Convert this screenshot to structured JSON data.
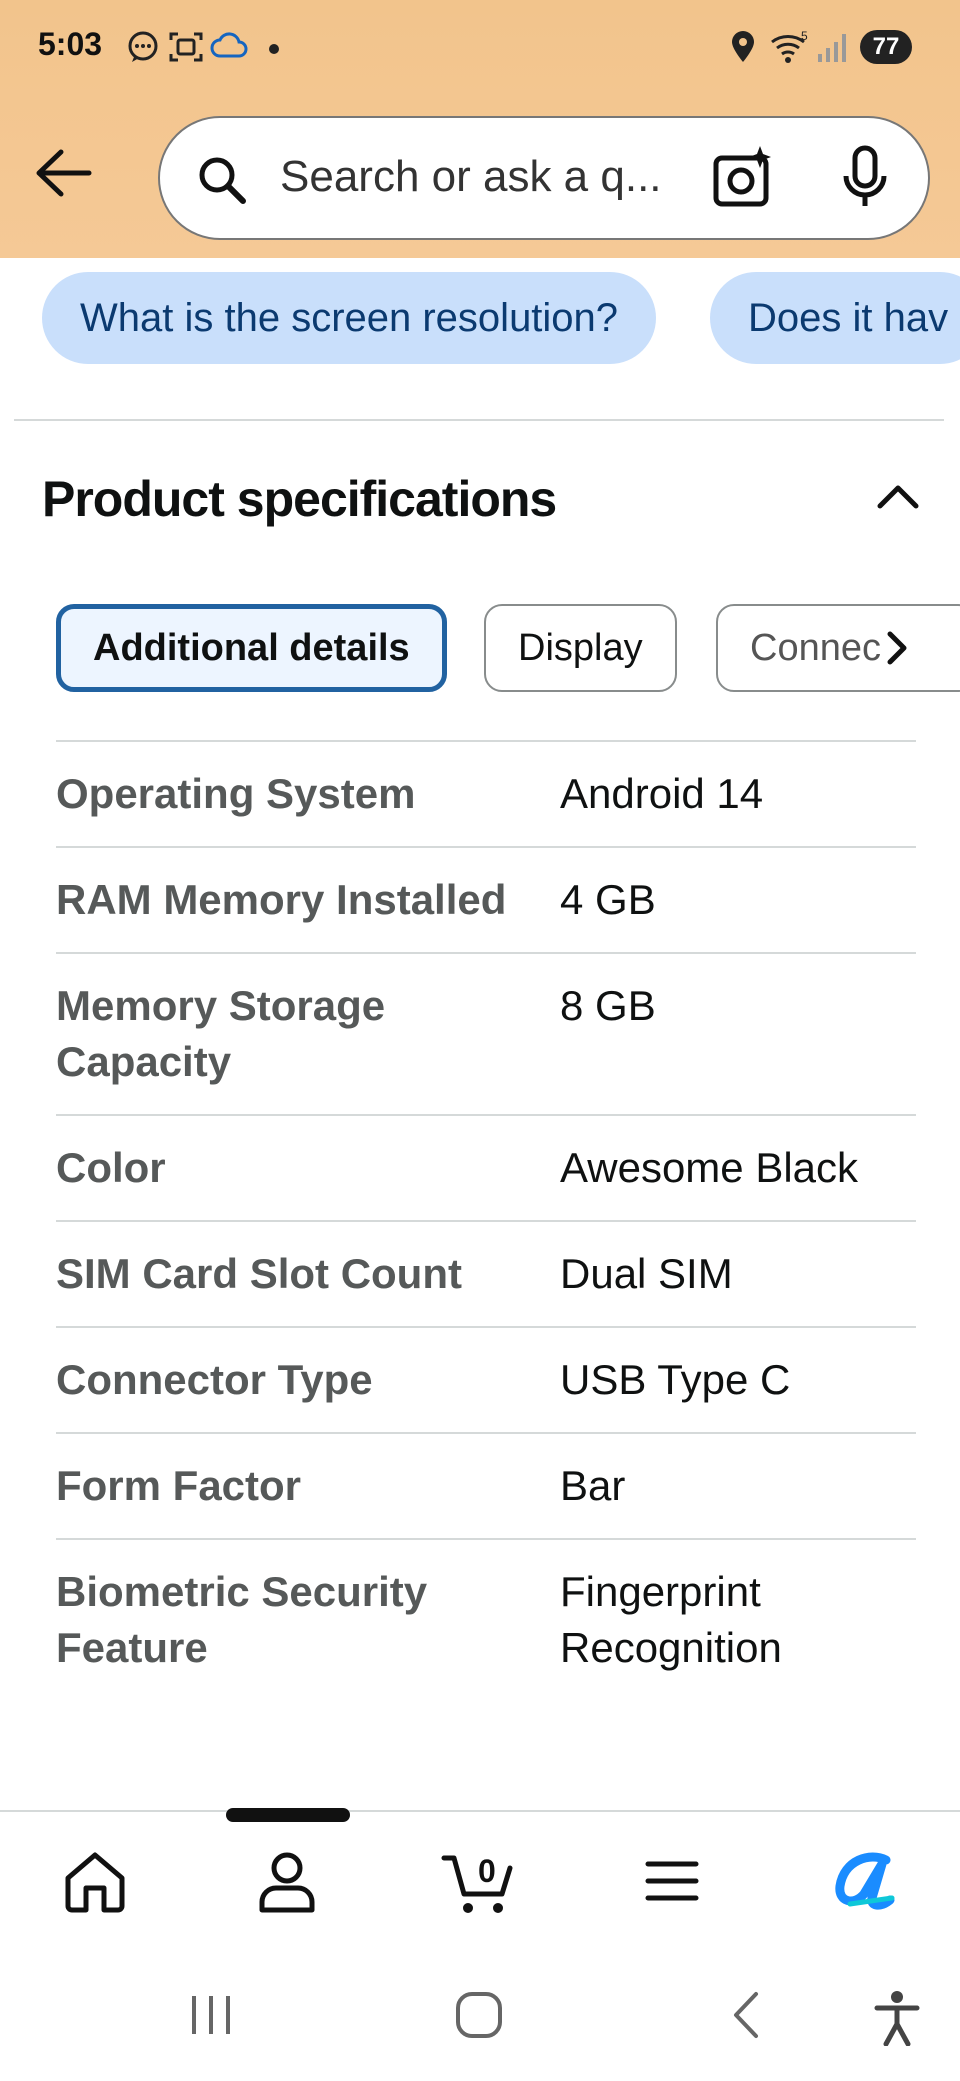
{
  "status_bar": {
    "time": "5:03",
    "battery": "77",
    "network_superscript": "5"
  },
  "header": {
    "search_placeholder": "Search or ask a q..."
  },
  "suggestion_chips": [
    "What is the screen resolution?",
    "Does it hav"
  ],
  "section": {
    "title": "Product specifications"
  },
  "tabs": [
    "Additional details",
    "Display",
    "Connec"
  ],
  "specs": [
    {
      "key": "Operating System",
      "value": "Android 14"
    },
    {
      "key": "RAM Memory Installed",
      "value": "4 GB"
    },
    {
      "key": "Memory Storage Capacity",
      "value": "8 GB"
    },
    {
      "key": "Color",
      "value": "Awesome Black"
    },
    {
      "key": "SIM Card Slot Count",
      "value": "Dual SIM"
    },
    {
      "key": "Connector Type",
      "value": "USB Type C"
    },
    {
      "key": "Form Factor",
      "value": "Bar"
    },
    {
      "key": "Biometric Security Feature",
      "value": "Fingerprint Recognition"
    }
  ],
  "bottom_nav": {
    "cart_count": "0",
    "items": [
      "home-icon",
      "account-icon",
      "cart-icon",
      "menu-icon",
      "rufus-icon"
    ]
  },
  "colors": {
    "header_bg": "#f2c48c",
    "chip_bg": "#c9dffb",
    "tab_active_border": "#2162a1",
    "rufus_blue": "#1a8cff"
  }
}
